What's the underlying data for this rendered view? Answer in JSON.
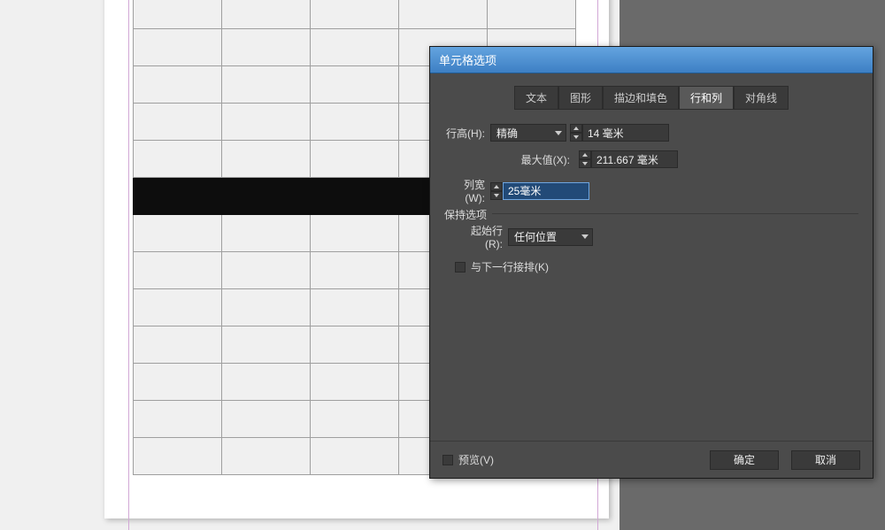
{
  "dialog": {
    "title": "单元格选项",
    "tabs": {
      "text": "文本",
      "shape": "图形",
      "stroke_fill": "描边和填色",
      "rows_cols": "行和列",
      "diagonal": "对角线"
    },
    "row_height": {
      "label": "行高(H):",
      "mode": "精确",
      "value": "14 毫米",
      "max_label": "最大值(X):",
      "max_value": "211.667 毫米"
    },
    "col_width": {
      "label": "列宽(W):",
      "value": "25毫米"
    },
    "keep": {
      "legend": "保持选项",
      "start_row_label": "起始行(R):",
      "start_row_value": "任何位置",
      "keep_with_next": "与下一行接排(K)"
    },
    "footer": {
      "preview": "预览(V)",
      "ok": "确定",
      "cancel": "取消"
    }
  }
}
